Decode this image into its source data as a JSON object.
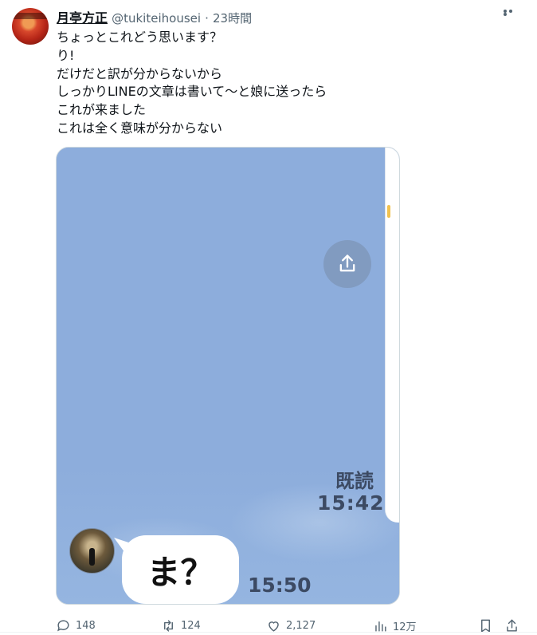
{
  "tweet": {
    "author_name": "月亭方正",
    "author_handle": "@tukiteihousei",
    "separator": "·",
    "timestamp": "23時間",
    "text_lines": [
      "ちょっとこれどう思います？",
      "り!",
      "だけだと訳が分からないから",
      "しっかりLINEの文章は書いて〜と娘に送ったら",
      "これが来ました",
      "これは全く意味が分からない"
    ]
  },
  "media": {
    "read_label": "既読",
    "read_time": "15:42",
    "reply_text": "ま？",
    "reply_time": "15:50",
    "share_icon": "share-icon"
  },
  "actions": {
    "replies": "148",
    "retweets": "124",
    "likes": "2,127",
    "views": "12万"
  },
  "colors": {
    "chat_background": "#8daddc",
    "muted_text": "#536471",
    "chat_meta": "#3c4a63"
  }
}
